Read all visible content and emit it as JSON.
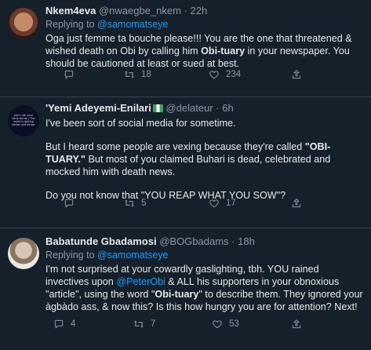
{
  "tweets": [
    {
      "name": "Nkem4eva",
      "handle": "@nwaegbe_nkem",
      "dot": "·",
      "time": "22h",
      "replying_prefix": "Replying to ",
      "replying_to": "@samomatseye",
      "text_1": "Oga just femme ta bouche please!!! You are the one that threatened & wished death on Obi by calling him ",
      "text_bold": "Obi-tuary",
      "text_2": " in your newspaper. You should be cautioned at least or sued at best.",
      "replies": "",
      "retweets": "18",
      "likes": "234"
    },
    {
      "name": "'Yemi Adeyemi-Enilari",
      "handle": "@delateur",
      "dot": "·",
      "time": "6h",
      "avatar_text": "John rush your lamb too oh / The world is getting darker and darker",
      "p1": "I've been sort of social media for sometime.",
      "p2_a": "But I heard some people are vexing because they're called ",
      "p2_bold": "\"OBI-TUARY.\"",
      "p2_b": " But most of you claimed Buhari is dead, celebrated and mocked him with death news.",
      "p3": "Do you not know that \"YOU REAP WHAT YOU SOW\"?",
      "replies": "",
      "retweets": "5",
      "likes": "17"
    },
    {
      "name": "Babatunde Gbadamosi",
      "handle": "@BOGbadams",
      "dot": "·",
      "time": "18h",
      "replying_prefix": "Replying to ",
      "replying_to": "@samomatseye",
      "text_1": "I'm not surprised at your cowardly gaslighting, tbh. YOU rained invectives upon ",
      "mention_2": "@PeterObi",
      "text_2": " & ALL his supporters in your obnoxious \"article\", using the word \"",
      "text_bold": "Obi-tuary",
      "text_3": "\" to describe them. They ignored your àgbàdo ass, & now this? Is this how hungry you are for attention? Next!",
      "replies": "4",
      "retweets": "7",
      "likes": "53"
    }
  ],
  "icons": [
    "reply-icon",
    "retweet-icon",
    "like-icon",
    "share-icon",
    "more-icon"
  ],
  "colors": {
    "background": "#15202b",
    "text": "#e7e9ea",
    "muted": "#8b98a5",
    "link": "#1d9bf0",
    "divider": "#38444d"
  }
}
